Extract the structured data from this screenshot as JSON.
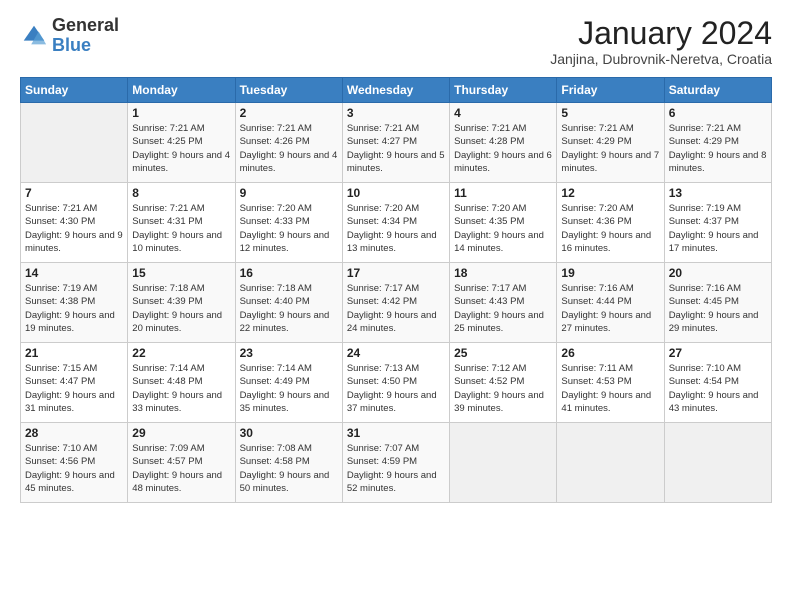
{
  "logo": {
    "general": "General",
    "blue": "Blue"
  },
  "header": {
    "title": "January 2024",
    "location": "Janjina, Dubrovnik-Neretva, Croatia"
  },
  "days_of_week": [
    "Sunday",
    "Monday",
    "Tuesday",
    "Wednesday",
    "Thursday",
    "Friday",
    "Saturday"
  ],
  "weeks": [
    [
      {
        "day": "",
        "sunrise": "",
        "sunset": "",
        "daylight": ""
      },
      {
        "day": "1",
        "sunrise": "Sunrise: 7:21 AM",
        "sunset": "Sunset: 4:25 PM",
        "daylight": "Daylight: 9 hours and 4 minutes."
      },
      {
        "day": "2",
        "sunrise": "Sunrise: 7:21 AM",
        "sunset": "Sunset: 4:26 PM",
        "daylight": "Daylight: 9 hours and 4 minutes."
      },
      {
        "day": "3",
        "sunrise": "Sunrise: 7:21 AM",
        "sunset": "Sunset: 4:27 PM",
        "daylight": "Daylight: 9 hours and 5 minutes."
      },
      {
        "day": "4",
        "sunrise": "Sunrise: 7:21 AM",
        "sunset": "Sunset: 4:28 PM",
        "daylight": "Daylight: 9 hours and 6 minutes."
      },
      {
        "day": "5",
        "sunrise": "Sunrise: 7:21 AM",
        "sunset": "Sunset: 4:29 PM",
        "daylight": "Daylight: 9 hours and 7 minutes."
      },
      {
        "day": "6",
        "sunrise": "Sunrise: 7:21 AM",
        "sunset": "Sunset: 4:29 PM",
        "daylight": "Daylight: 9 hours and 8 minutes."
      }
    ],
    [
      {
        "day": "7",
        "sunrise": "Sunrise: 7:21 AM",
        "sunset": "Sunset: 4:30 PM",
        "daylight": "Daylight: 9 hours and 9 minutes."
      },
      {
        "day": "8",
        "sunrise": "Sunrise: 7:21 AM",
        "sunset": "Sunset: 4:31 PM",
        "daylight": "Daylight: 9 hours and 10 minutes."
      },
      {
        "day": "9",
        "sunrise": "Sunrise: 7:20 AM",
        "sunset": "Sunset: 4:33 PM",
        "daylight": "Daylight: 9 hours and 12 minutes."
      },
      {
        "day": "10",
        "sunrise": "Sunrise: 7:20 AM",
        "sunset": "Sunset: 4:34 PM",
        "daylight": "Daylight: 9 hours and 13 minutes."
      },
      {
        "day": "11",
        "sunrise": "Sunrise: 7:20 AM",
        "sunset": "Sunset: 4:35 PM",
        "daylight": "Daylight: 9 hours and 14 minutes."
      },
      {
        "day": "12",
        "sunrise": "Sunrise: 7:20 AM",
        "sunset": "Sunset: 4:36 PM",
        "daylight": "Daylight: 9 hours and 16 minutes."
      },
      {
        "day": "13",
        "sunrise": "Sunrise: 7:19 AM",
        "sunset": "Sunset: 4:37 PM",
        "daylight": "Daylight: 9 hours and 17 minutes."
      }
    ],
    [
      {
        "day": "14",
        "sunrise": "Sunrise: 7:19 AM",
        "sunset": "Sunset: 4:38 PM",
        "daylight": "Daylight: 9 hours and 19 minutes."
      },
      {
        "day": "15",
        "sunrise": "Sunrise: 7:18 AM",
        "sunset": "Sunset: 4:39 PM",
        "daylight": "Daylight: 9 hours and 20 minutes."
      },
      {
        "day": "16",
        "sunrise": "Sunrise: 7:18 AM",
        "sunset": "Sunset: 4:40 PM",
        "daylight": "Daylight: 9 hours and 22 minutes."
      },
      {
        "day": "17",
        "sunrise": "Sunrise: 7:17 AM",
        "sunset": "Sunset: 4:42 PM",
        "daylight": "Daylight: 9 hours and 24 minutes."
      },
      {
        "day": "18",
        "sunrise": "Sunrise: 7:17 AM",
        "sunset": "Sunset: 4:43 PM",
        "daylight": "Daylight: 9 hours and 25 minutes."
      },
      {
        "day": "19",
        "sunrise": "Sunrise: 7:16 AM",
        "sunset": "Sunset: 4:44 PM",
        "daylight": "Daylight: 9 hours and 27 minutes."
      },
      {
        "day": "20",
        "sunrise": "Sunrise: 7:16 AM",
        "sunset": "Sunset: 4:45 PM",
        "daylight": "Daylight: 9 hours and 29 minutes."
      }
    ],
    [
      {
        "day": "21",
        "sunrise": "Sunrise: 7:15 AM",
        "sunset": "Sunset: 4:47 PM",
        "daylight": "Daylight: 9 hours and 31 minutes."
      },
      {
        "day": "22",
        "sunrise": "Sunrise: 7:14 AM",
        "sunset": "Sunset: 4:48 PM",
        "daylight": "Daylight: 9 hours and 33 minutes."
      },
      {
        "day": "23",
        "sunrise": "Sunrise: 7:14 AM",
        "sunset": "Sunset: 4:49 PM",
        "daylight": "Daylight: 9 hours and 35 minutes."
      },
      {
        "day": "24",
        "sunrise": "Sunrise: 7:13 AM",
        "sunset": "Sunset: 4:50 PM",
        "daylight": "Daylight: 9 hours and 37 minutes."
      },
      {
        "day": "25",
        "sunrise": "Sunrise: 7:12 AM",
        "sunset": "Sunset: 4:52 PM",
        "daylight": "Daylight: 9 hours and 39 minutes."
      },
      {
        "day": "26",
        "sunrise": "Sunrise: 7:11 AM",
        "sunset": "Sunset: 4:53 PM",
        "daylight": "Daylight: 9 hours and 41 minutes."
      },
      {
        "day": "27",
        "sunrise": "Sunrise: 7:10 AM",
        "sunset": "Sunset: 4:54 PM",
        "daylight": "Daylight: 9 hours and 43 minutes."
      }
    ],
    [
      {
        "day": "28",
        "sunrise": "Sunrise: 7:10 AM",
        "sunset": "Sunset: 4:56 PM",
        "daylight": "Daylight: 9 hours and 45 minutes."
      },
      {
        "day": "29",
        "sunrise": "Sunrise: 7:09 AM",
        "sunset": "Sunset: 4:57 PM",
        "daylight": "Daylight: 9 hours and 48 minutes."
      },
      {
        "day": "30",
        "sunrise": "Sunrise: 7:08 AM",
        "sunset": "Sunset: 4:58 PM",
        "daylight": "Daylight: 9 hours and 50 minutes."
      },
      {
        "day": "31",
        "sunrise": "Sunrise: 7:07 AM",
        "sunset": "Sunset: 4:59 PM",
        "daylight": "Daylight: 9 hours and 52 minutes."
      },
      {
        "day": "",
        "sunrise": "",
        "sunset": "",
        "daylight": ""
      },
      {
        "day": "",
        "sunrise": "",
        "sunset": "",
        "daylight": ""
      },
      {
        "day": "",
        "sunrise": "",
        "sunset": "",
        "daylight": ""
      }
    ]
  ]
}
